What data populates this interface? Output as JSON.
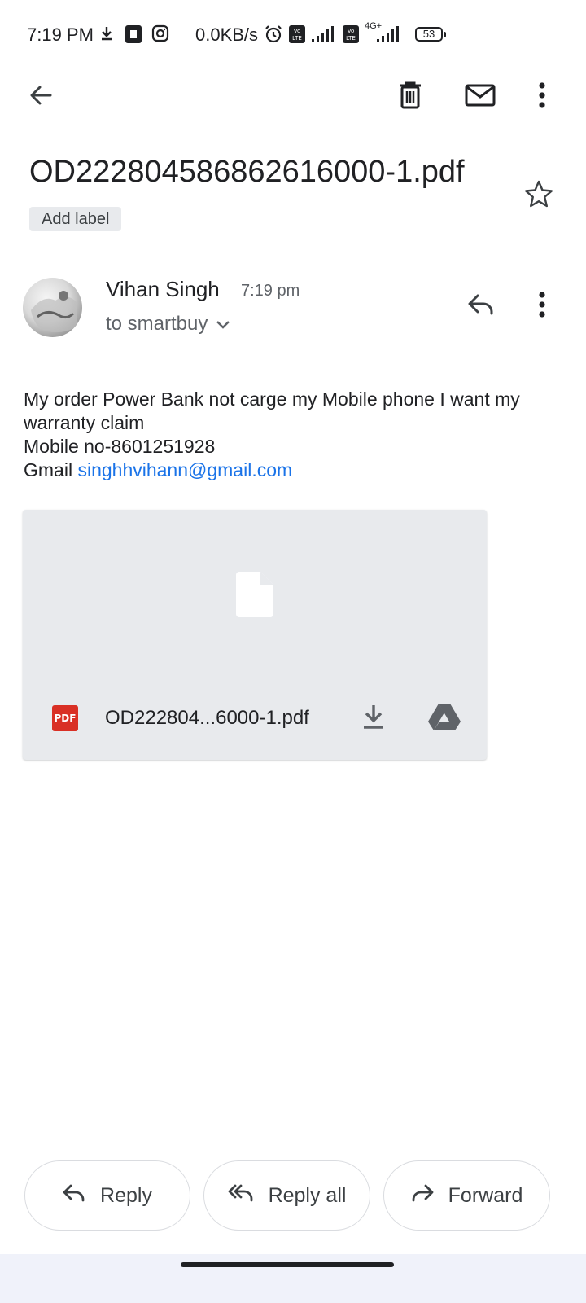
{
  "status_bar": {
    "time": "7:19 PM",
    "net_speed": "0.0KB/s",
    "network_label": "4G+",
    "battery": "53",
    "icons": [
      "download-icon",
      "sim-icon",
      "instagram-icon",
      "alarm-icon",
      "volte-icon",
      "signal-icon",
      "volte-icon",
      "signal-icon",
      "battery-icon"
    ]
  },
  "toolbar": {
    "icons": [
      "back-arrow-icon",
      "trash-icon",
      "mail-icon",
      "more-vert-icon"
    ]
  },
  "email": {
    "subject": "OD222804586862616000-1.pdf",
    "add_label": "Add label",
    "sender_name": "Vihan Singh",
    "time": "7:19 pm",
    "recipient": "to smartbuy",
    "body": {
      "line1": "My order Power Bank not carge my Mobile phone I want my warranty claim",
      "line2": "Mobile no-8601251928",
      "line3_prefix": "Gmail",
      "line3_link": "singhhvihann@gmail.com"
    }
  },
  "attachment": {
    "badge": "PDF",
    "name": "OD222804...6000-1.pdf",
    "icons": [
      "file-icon",
      "download-icon",
      "drive-icon"
    ]
  },
  "actions": {
    "reply": "Reply",
    "reply_all": "Reply all",
    "forward": "Forward"
  },
  "colors": {
    "link": "#1a73e8",
    "pdf_red": "#d93025",
    "attachment_bg": "#e8eaed",
    "text": "#202124",
    "secondary_text": "#5f6368"
  }
}
